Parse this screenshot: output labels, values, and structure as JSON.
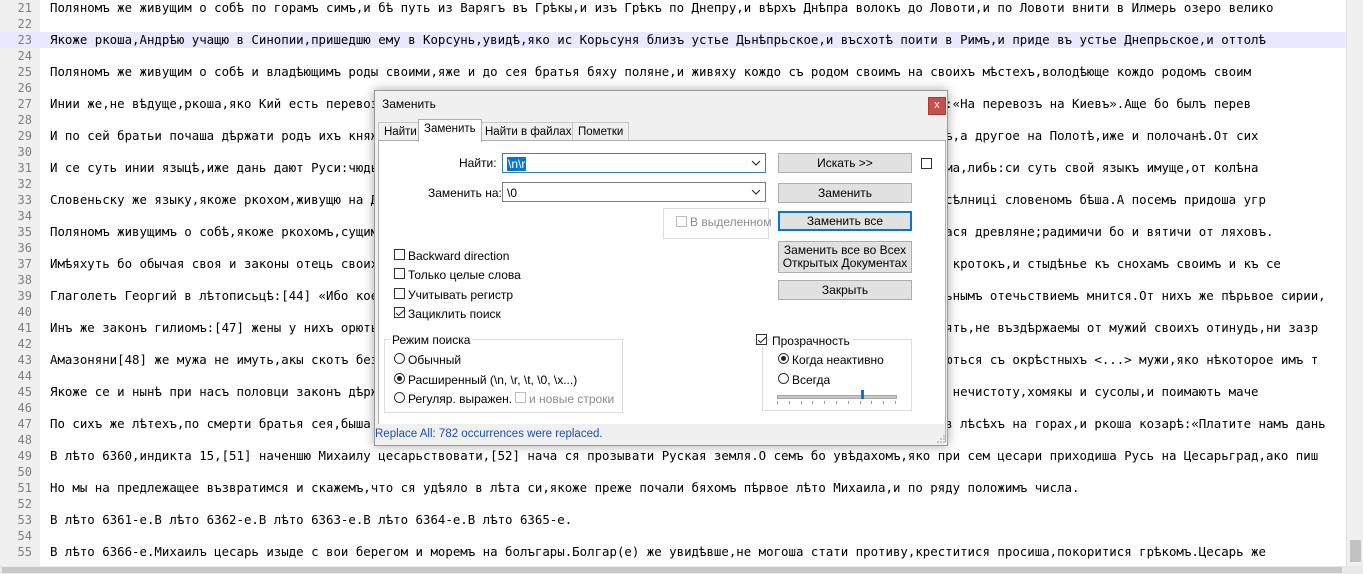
{
  "editor": {
    "lines": [
      {
        "num": "21",
        "text": "Поляномъ же живущим о собѣ по горамъ симъ,и бѣ путь из Варягъ въ Грѣкы,и изъ Грѣкъ по Днепру,и вѣрхъ Днѣпра волокъ до Ловоти,и по Ловоти внити в Илмерь озеро велико"
      },
      {
        "num": "22",
        "text": ""
      },
      {
        "num": "23",
        "text": "Якоже ркоша,Андрѣю учащю в Синопии,пришедшю ему в Корсунь,увидѣ,яко ис Корьсуня близъ устье Дьнѣпрьское,и въсхотѣ поити в Римъ,и приде въ устье Днепрьское,и оттолѣ"
      },
      {
        "num": "24",
        "text": ""
      },
      {
        "num": "25",
        "text": "Поляномъ же живущим о собѣ и владѣющимъ роды своими,яже и до сея братья бяху поляне,и живяху кождо съ родом своимъ на своихъ мѣстехъ,володѣюще кождо родомъ своим"
      },
      {
        "num": "26",
        "text": ""
      },
      {
        "num": "27",
        "text": "Инии же,не вѣдуще,ркоша,яко Кий есть перевозникъ былъ,у Киева бо бяше перевозъ тогда с оноя страны Днепра,тѣмь глаголаху:«На перевозъ на Киевъ».Аще бо былъ перев"
      },
      {
        "num": "28",
        "text": ""
      },
      {
        "num": "29",
        "text": "И по сей братьи почаша дѣржати родъ ихъ княжение в поляхъ,а в деревляхъ свое,а дреговичи свое,а словѣни свое в Новѣгородѣ,а другое на Полотѣ,иже и полочанѣ.От сих"
      },
      {
        "num": "30",
        "text": ""
      },
      {
        "num": "31",
        "text": "И се суть инии языцѣ,иже дань дают Руси:чюдь,меря,весь,мурома,черемись,мордва,пѣрмь,печера,ямь,литва,зимигола,корсь,нерома,либь:си суть свой языкъ имуще,от колѣна"
      },
      {
        "num": "32",
        "text": ""
      },
      {
        "num": "33",
        "text": "Словеньску же языку,якоже ркохом,живущю на Дунаи,придоша от скуфъ,рекше от козаръ,рекомии болгаре,и сѣдоша по Дунаеви,насѣлниці словеномъ бѣша.А посемъ придоша угр"
      },
      {
        "num": "34",
        "text": ""
      },
      {
        "num": "35",
        "text": "Поляномъ живущимъ о собѣ,якоже ркохомъ,сущимъ от рода словеньска и нарекошася поляне,а деревляне от словенъ же,и нарекошася древляне;радимичи бо и вятичи от ляховъ."
      },
      {
        "num": "36",
        "text": ""
      },
      {
        "num": "37",
        "text": "Имѣяхуть бо обычая своя и законы отець своихъ и преданья,кождо свой нравъ.Поляне бо своихъ отець обычай имуть кроткихъ и кротокъ,и стыдѣнье къ снохамъ своимъ и къ се"
      },
      {
        "num": "38",
        "text": ""
      },
      {
        "num": "39",
        "text": "Глаголеть Георгий в лѣтописьцѣ:[44] «Ибо коемуждо языку овѣмъ исписанъ законъ есть,другимъ же обычаи,зане законъ безаконьнымъ отечьствиемь мнится.От нихъ же пѣрьвое сирии,"
      },
      {
        "num": "40",
        "text": ""
      },
      {
        "num": "41",
        "text": "Инъ же законъ гилиомъ:[47] жены у нихъ орють,и храмины зиждуть,и мужьская дѣла творять,но и любодѣяния творять елико хотять,не въздѣржаемы от мужий своихъ отинудь,ни зазр"
      },
      {
        "num": "42",
        "text": ""
      },
      {
        "num": "43",
        "text": "Амазоняни[48] же мужа не имуть,акы скотъ безсловесный,но единою лѣтомъ къ вешнимъ днемъ отидуть своихъ земль и совокупляються съ окрѣстныхъ <...> мужи,яко нѣкоторое имъ т"
      },
      {
        "num": "44",
        "text": ""
      },
      {
        "num": "45",
        "text": "Якоже се и нынѣ при насъ половци законъ дѣржать отець своихъ,кровь проливати,а хвалящеся о сихъ,и ядуще мертвечину и всю нечистоту,хомякы и сусолы,и поимають маче"
      },
      {
        "num": "46",
        "text": ""
      },
      {
        "num": "47",
        "text": "По сихъ же лѣтехъ,по смерти братья сея,быша обидимы древлями и инѣми околними,и наидоша я козари,сѣдящая на горахъ сихъ в лѣсѣхъ на горах,и ркоша козарѣ:«Платите намъ дань"
      },
      {
        "num": "48",
        "text": ""
      },
      {
        "num": "49",
        "text": "В лѣто 6360,индикта 15,[51] наченшю Михаилу цесарьствовати,[52] нача ся прозывати Руская земля.О семъ бо увѣдахомъ,яко при сем цесари приходиша Русь на Цесарьград,ако пиш"
      },
      {
        "num": "50",
        "text": ""
      },
      {
        "num": "51",
        "text": "Но мы на предлежащее възвратимся и скажемъ,что ся удѣяло в лѣта си,якоже преже почали бяхомъ пѣрвое лѣто Михаила,и по ряду положимъ числа."
      },
      {
        "num": "52",
        "text": ""
      },
      {
        "num": "53",
        "text": "В лѣто 6361-е.В лѣто 6362-е.В лѣто 6363-е.В лѣто 6364-е.В лѣто 6365-е."
      },
      {
        "num": "54",
        "text": ""
      },
      {
        "num": "55",
        "text": "В лѣто 6366-е.Михаилъ цесарь изыде с вои берегом и моремъ на болъгары.Болгар(е) же увидѣвше,не могоша стати противу,креститися просиша,покоритися грѣкомъ.Цесарь же"
      }
    ]
  },
  "dialog": {
    "title": "Заменить",
    "close_label": "x",
    "tabs": [
      {
        "label": "Найти"
      },
      {
        "label": "Заменить"
      },
      {
        "label": "Найти в файлах"
      },
      {
        "label": "Пометки"
      }
    ],
    "find": {
      "label": "Найти:",
      "value": "\\n\\r"
    },
    "replace": {
      "label": "Заменить на:",
      "value": "\\0"
    },
    "in_selection": {
      "label": "В выделенном",
      "checked": false
    },
    "buttons": {
      "find_next": "Искать >>",
      "replace": "Заменить",
      "replace_all": "Заменить все",
      "replace_all_docs_1": "Заменить все во Всех",
      "replace_all_docs_2": "Открытых Документах",
      "close": "Закрыть"
    },
    "options": [
      {
        "label": "Backward direction",
        "checked": false
      },
      {
        "label": "Только целые слова",
        "checked": false
      },
      {
        "label": "Учитывать регистр",
        "checked": false
      },
      {
        "label": "Зациклить поиск",
        "checked": true
      }
    ],
    "search_mode": {
      "title": "Режим поиска",
      "modes": [
        {
          "label": "Обычный",
          "selected": false
        },
        {
          "label": "Расширенный (\\n, \\r, \\t, \\0, \\x...)",
          "selected": true
        },
        {
          "label": "Регуляр. выражен.",
          "selected": false
        }
      ],
      "newlines_label": "и новые строки"
    },
    "transparency": {
      "label": "Прозрачность",
      "checked": true,
      "modes": [
        {
          "label": "Когда неактивно",
          "selected": true
        },
        {
          "label": "Всегда",
          "selected": false
        }
      ],
      "level": 0.72
    },
    "status": "Replace All: 782 occurrences were replaced."
  }
}
